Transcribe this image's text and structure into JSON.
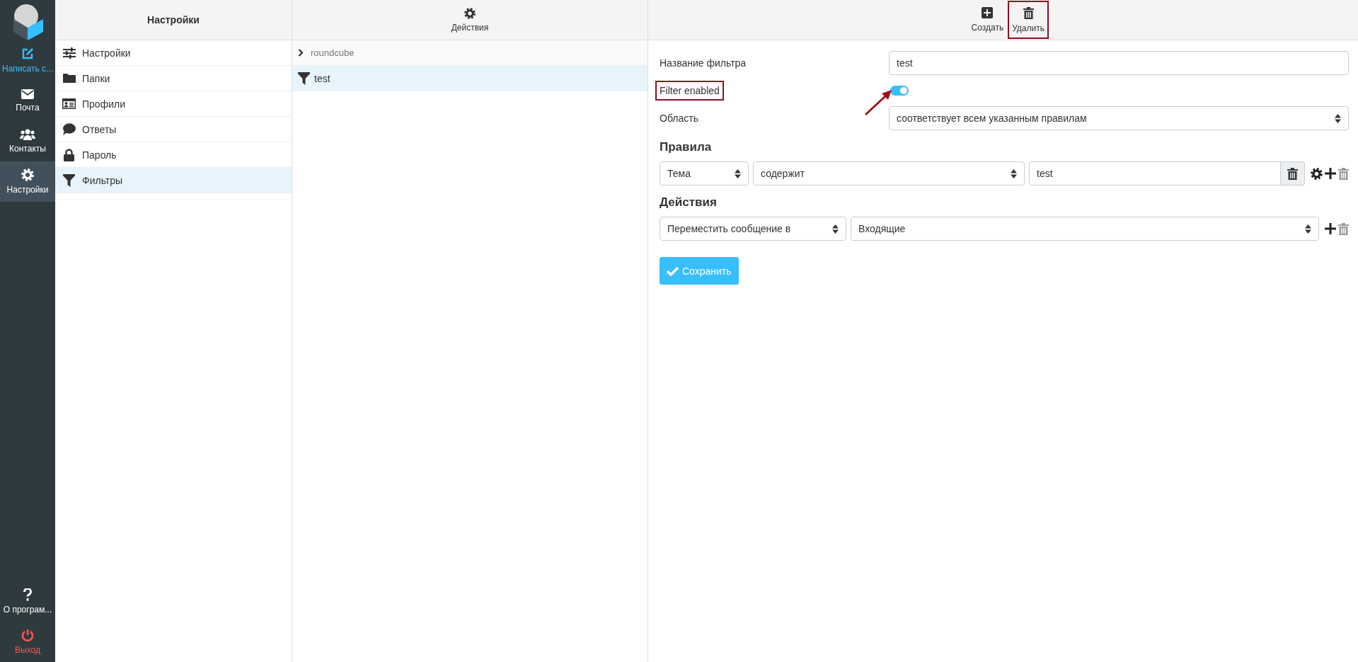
{
  "nav": {
    "items": [
      {
        "label": "Написать с...",
        "color": "#37beff",
        "selected": false
      },
      {
        "label": "Почта",
        "color": "#ffffff",
        "selected": false
      },
      {
        "label": "Контакты",
        "color": "#ffffff",
        "selected": false
      },
      {
        "label": "Настройки",
        "color": "#ffffff",
        "selected": true
      }
    ],
    "footer": [
      {
        "label": "О програм...",
        "color": "#ffffff"
      },
      {
        "label": "Выход",
        "color": "#ff5552"
      }
    ]
  },
  "settings": {
    "title": "Настройки",
    "items": [
      {
        "label": "Настройки",
        "selected": false
      },
      {
        "label": "Папки",
        "selected": false
      },
      {
        "label": "Профили",
        "selected": false
      },
      {
        "label": "Ответы",
        "selected": false
      },
      {
        "label": "Пароль",
        "selected": false
      },
      {
        "label": "Фильтры",
        "selected": true
      }
    ]
  },
  "filters": {
    "toolbar": [
      {
        "label": "Действия"
      }
    ],
    "sets": [
      {
        "label": "roundcube"
      }
    ],
    "items": [
      {
        "label": "test",
        "selected": true
      }
    ]
  },
  "form": {
    "toolbar": [
      {
        "label": "Создать",
        "highlighted": false
      },
      {
        "label": "Удалить",
        "highlighted": true
      }
    ],
    "fields": [
      {
        "kind": "text",
        "label": "Название фильтра",
        "value": "test",
        "highlighted": false,
        "pointer_arrow": false
      },
      {
        "kind": "toggle",
        "label": "Filter enabled",
        "on": true,
        "highlighted": true,
        "pointer_arrow": true
      },
      {
        "kind": "select",
        "label": "Область",
        "value": "соответствует всем указанным правилам",
        "highlighted": false,
        "pointer_arrow": false
      }
    ],
    "rules": {
      "title": "Правила",
      "rows": [
        {
          "fields": [
            {
              "kind": "select",
              "value": "Тема"
            },
            {
              "kind": "select",
              "value": "содержит"
            },
            {
              "kind": "text",
              "value": "test"
            }
          ]
        }
      ]
    },
    "actions": {
      "title": "Действия",
      "rows": [
        {
          "fields": [
            {
              "kind": "select",
              "value": "Переместить сообщение в"
            },
            {
              "kind": "select",
              "value": "Входящие"
            }
          ]
        }
      ]
    },
    "save": {
      "label": "Сохранить"
    }
  }
}
